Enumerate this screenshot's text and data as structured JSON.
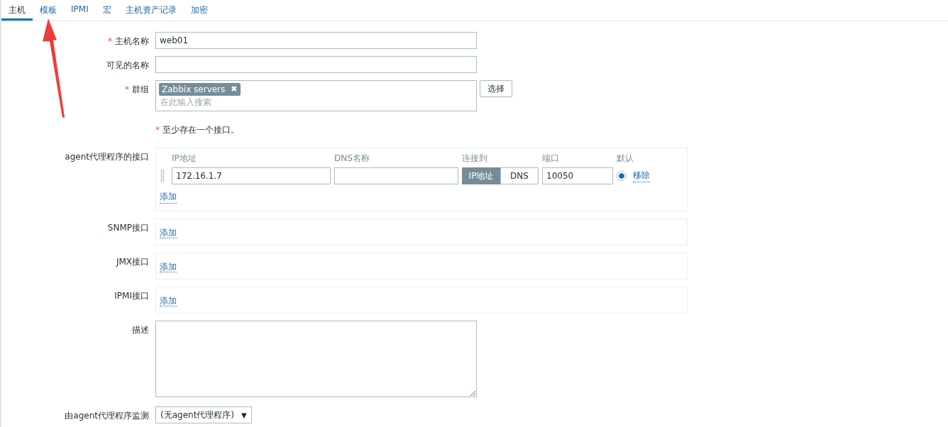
{
  "tabs": [
    {
      "label": "主机",
      "selected": true
    },
    {
      "label": "模板",
      "selected": false
    },
    {
      "label": "IPMI",
      "selected": false
    },
    {
      "label": "宏",
      "selected": false
    },
    {
      "label": "主机资产记录",
      "selected": false
    },
    {
      "label": "加密",
      "selected": false
    }
  ],
  "host_name": {
    "mark": "*",
    "label": "主机名称",
    "value": "web01"
  },
  "visible_name": {
    "label": "可见的名称"
  },
  "groups": {
    "mark": "*",
    "label": "群组",
    "tags": [
      {
        "label": "Zabbix servers",
        "remove": "✖"
      }
    ],
    "placeholder": "在此输入搜索",
    "button": "选择"
  },
  "note": {
    "mark": "*",
    "text": "至少存在一个接口。"
  },
  "agent": {
    "label": "agent代理程序的接口",
    "columns": [
      "IP地址",
      "DNS名称",
      "连接到",
      "端口",
      "默认"
    ],
    "rows": [
      {
        "ip": "172.16.1.7",
        "connect": [
          {
            "label": "IP地址",
            "selected": true
          },
          {
            "label": "DNS",
            "selected": false
          }
        ],
        "port": "10050",
        "default": true,
        "remove": "移除"
      }
    ],
    "add": "添加"
  },
  "other_interfaces": [
    {
      "label": "SNMP接口",
      "add": "添加"
    },
    {
      "label": "JMX接口",
      "add": "添加"
    },
    {
      "label": "IPMI接口",
      "add": "添加"
    }
  ],
  "description": {
    "label": "描述"
  },
  "proxy": {
    "label": "由agent代理程序监测",
    "value": "(无agent代理程序)",
    "caret": "▼"
  }
}
